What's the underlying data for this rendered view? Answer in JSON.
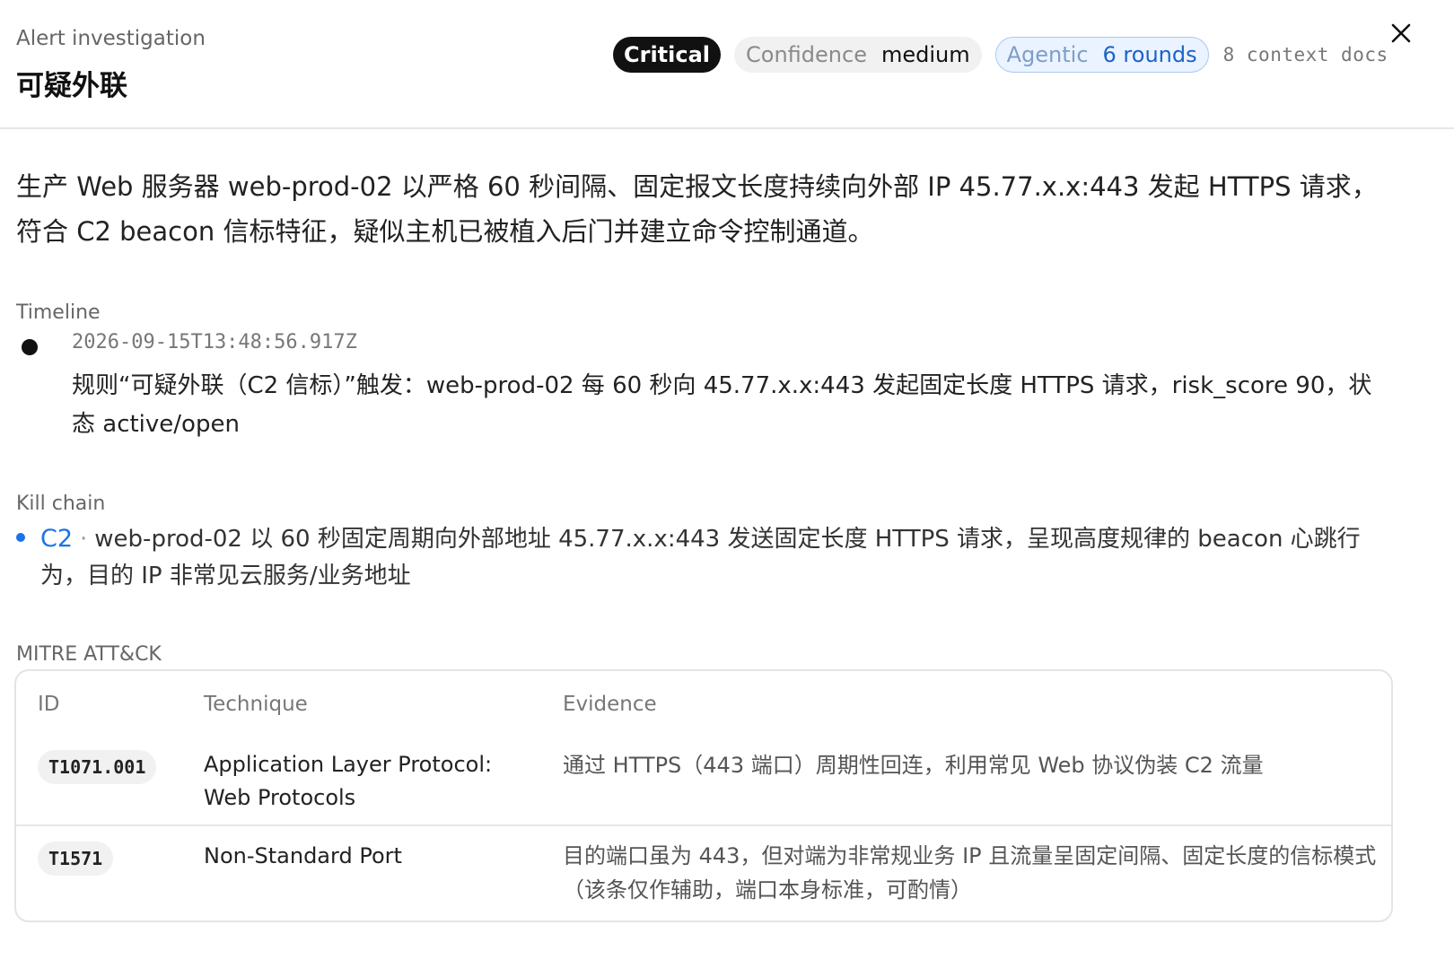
{
  "header": {
    "kicker": "Alert investigation",
    "title": "可疑外联",
    "severity": "Critical",
    "confidence_label": "Confidence",
    "confidence_value": "medium",
    "agentic_label": "Agentic",
    "agentic_value": "6 rounds",
    "context_docs": "8 context docs"
  },
  "summary": "生产 Web 服务器 web-prod-02 以严格 60 秒间隔、固定报文长度持续向外部 IP 45.77.x.x:443 发起 HTTPS 请求，符合 C2 beacon 信标特征，疑似主机已被植入后门并建立命令控制通道。",
  "timeline": {
    "label": "Timeline",
    "events": [
      {
        "time": "2026-09-15T13:48:56.917Z",
        "text": "规则“可疑外联（C2 信标）”触发：web-prod-02 每 60 秒向 45.77.x.x:443 发起固定长度 HTTPS 请求，risk_score 90，状态 active/open"
      }
    ]
  },
  "kill_chain": {
    "label": "Kill chain",
    "items": [
      {
        "stage": "C2",
        "separator": "·",
        "text": "web-prod-02 以 60 秒固定周期向外部地址 45.77.x.x:443 发送固定长度 HTTPS 请求，呈现高度规律的 beacon 心跳行为，目的 IP 非常见云服务/业务地址"
      }
    ]
  },
  "mitre": {
    "label": "MITRE ATT&CK",
    "columns": [
      "ID",
      "Technique",
      "Evidence"
    ],
    "rows": [
      {
        "id": "T1071.001",
        "technique": "Application Layer Protocol: Web Protocols",
        "evidence": "通过 HTTPS（443 端口）周期性回连，利用常见 Web 协议伪装 C2 流量"
      },
      {
        "id": "T1571",
        "technique": "Non-Standard Port",
        "evidence": "目的端口虽为 443，但对端为非常规业务 IP 且流量呈固定间隔、固定长度的信标模式（该条仅作辅助，端口本身标准，可酌情）"
      }
    ]
  },
  "icons": {
    "close": "close-icon",
    "timeline_dot": "timeline-dot-icon",
    "bullet": "bullet-dot-icon"
  },
  "colors": {
    "accent_blue": "#1b73e8",
    "critical_bg": "#111111",
    "agentic_bg": "#eaf3ff"
  }
}
